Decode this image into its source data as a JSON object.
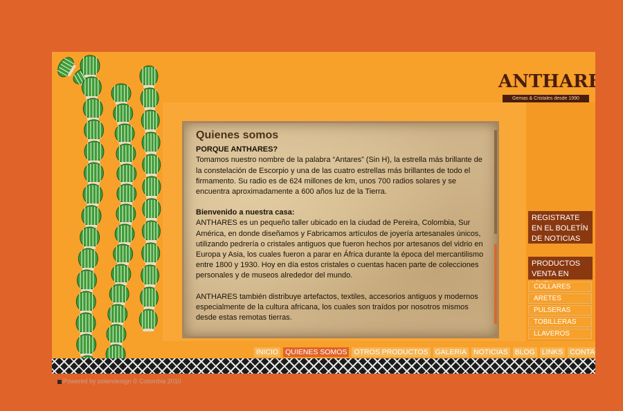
{
  "logo": {
    "name": "ANTHARES",
    "tagline": "Gemas & Cristales desde 1990"
  },
  "content": {
    "title": "Quienes somos",
    "subtitle": "PORQUE ANTHARES?",
    "paragraph1": "Tomamos nuestro nombre de la palabra “Antares” (Sin H), la estrella más brillante de la constelación de Escorpio y una de las cuatro estrellas más brillantes de todo el firmamento. Su radio es de 624 millones de km, unos 700 radios solares y se encuentra aproximadamente a 600 años luz de la Tierra.",
    "welcome_heading": "Bienvenido a nuestra casa:",
    "paragraph2": " ANTHARES es un pequeño taller ubicado en la ciudad de Pereira, Colombia, Sur América, en donde diseñamos y Fabricamos  artículos de joyería artesanales únicos, utilizando pedrería o cristales antiguos que fueron hechos por artesanos del vidrio en Europa y Asia, los cuales fueron a parar en África durante la época del mercantilismo entre 1800 y 1930.  Hoy en día estos cristales o cuentas hacen parte de colecciones personales y de museos alrededor del mundo.",
    "paragraph3": "ANTHARES también distribuye artefactos, textiles, accesorios antiguos y modernos especialmente de la cultura africana, los cuales son traídos por nosotros mismos desde estas remotas tierras."
  },
  "sidebar": {
    "newsletter_label": "REGISTRATE EN EL BOLETÍN DE NOTICIAS",
    "products_title": "PRODUCTOS VENTA EN LÍNEA",
    "products": [
      "COLLARES",
      "ARETES",
      "PULSERAS",
      "TOBILLERAS",
      "LLAVEROS"
    ]
  },
  "nav": {
    "items": [
      "INICIO",
      "QUIENES SOMOS",
      "OTROS PRODUCTOS",
      "GALERIA",
      "NOTICIAS",
      "BLOG",
      "LINKS",
      "CONTACTO"
    ],
    "active": "QUIENES SOMOS"
  },
  "footer": {
    "text": "Powered by polendesign © Colombia 2010"
  },
  "colors": {
    "background": "#e0632a",
    "site": "#f7a02a",
    "accent_dark": "#8a3810",
    "bead_green": "#3f9a3a"
  }
}
